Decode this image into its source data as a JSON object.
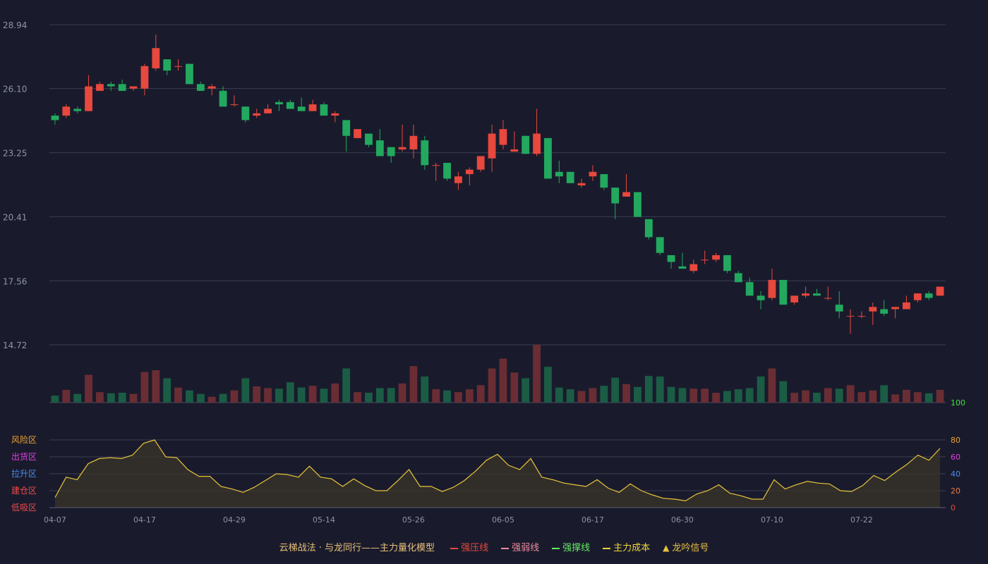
{
  "colors": {
    "up": "#e8483d",
    "down": "#22a95f",
    "vol_up": "#6a2d33",
    "vol_down": "#1b5c45",
    "line": "#e8c43a",
    "area": "#3a3528",
    "grid": "#3a3e52"
  },
  "legend": {
    "title": "云梯战法 · 与龙同行——主力量化模型",
    "title_color": "#e8c07a",
    "items": [
      {
        "label": "强压线",
        "marker": "line-solid",
        "color": "#e8483d"
      },
      {
        "label": "强弱线",
        "marker": "line-dashed",
        "color": "#f08aa0"
      },
      {
        "label": "强撑线",
        "marker": "line-solid",
        "color": "#66e866"
      },
      {
        "label": "主力成本",
        "marker": "line-dashed",
        "color": "#f0d53a"
      },
      {
        "label": "龙吟信号",
        "marker": "triangle",
        "color": "#e8c043"
      }
    ]
  },
  "chart_data": [
    {
      "type": "candlestick",
      "y_ticks": [
        "28.94",
        "26.10",
        "23.25",
        "20.41",
        "17.56",
        "14.72"
      ],
      "ylim": [
        14.72,
        28.94
      ],
      "x_labels": [
        {
          "index": 0,
          "label": "04-07"
        },
        {
          "index": 8,
          "label": "04-17"
        },
        {
          "index": 16,
          "label": "04-29"
        },
        {
          "index": 24,
          "label": "05-14"
        },
        {
          "index": 32,
          "label": "05-26"
        },
        {
          "index": 40,
          "label": "06-05"
        },
        {
          "index": 48,
          "label": "06-17"
        },
        {
          "index": 56,
          "label": "06-30"
        },
        {
          "index": 64,
          "label": "07-10"
        },
        {
          "index": 72,
          "label": "07-22"
        }
      ],
      "ohlc": [
        [
          24.9,
          25.0,
          24.5,
          24.7
        ],
        [
          24.9,
          25.4,
          24.8,
          25.3
        ],
        [
          25.2,
          25.3,
          25.0,
          25.1
        ],
        [
          25.1,
          26.7,
          25.1,
          26.2
        ],
        [
          26.0,
          26.4,
          26.0,
          26.3
        ],
        [
          26.3,
          26.4,
          26.0,
          26.2
        ],
        [
          26.3,
          26.5,
          26.0,
          26.0
        ],
        [
          26.1,
          26.2,
          26.0,
          26.2
        ],
        [
          26.1,
          27.2,
          25.8,
          27.1
        ],
        [
          27.0,
          28.5,
          26.9,
          27.9
        ],
        [
          27.4,
          27.4,
          26.7,
          26.9
        ],
        [
          27.1,
          27.4,
          26.9,
          27.1
        ],
        [
          27.2,
          27.2,
          26.3,
          26.3
        ],
        [
          26.3,
          26.4,
          26.0,
          26.0
        ],
        [
          26.1,
          26.3,
          25.8,
          26.2
        ],
        [
          26.0,
          26.2,
          25.3,
          25.3
        ],
        [
          25.4,
          25.8,
          25.3,
          25.4
        ],
        [
          25.3,
          25.3,
          24.6,
          24.7
        ],
        [
          24.9,
          25.2,
          24.8,
          25.0
        ],
        [
          25.0,
          25.4,
          25.0,
          25.2
        ],
        [
          25.5,
          25.6,
          25.1,
          25.4
        ],
        [
          25.5,
          25.6,
          25.2,
          25.2
        ],
        [
          25.3,
          25.7,
          25.2,
          25.1
        ],
        [
          25.1,
          25.6,
          25.1,
          25.4
        ],
        [
          25.4,
          25.5,
          24.9,
          24.9
        ],
        [
          24.9,
          25.1,
          24.6,
          25.0
        ],
        [
          24.7,
          24.7,
          23.3,
          24.0
        ],
        [
          23.9,
          24.3,
          23.9,
          24.3
        ],
        [
          24.1,
          24.1,
          23.5,
          23.6
        ],
        [
          23.8,
          24.3,
          23.1,
          23.1
        ],
        [
          23.5,
          23.5,
          22.8,
          23.1
        ],
        [
          23.4,
          24.5,
          23.3,
          23.5
        ],
        [
          23.4,
          24.5,
          23.0,
          24.0
        ],
        [
          23.8,
          24.0,
          22.5,
          22.7
        ],
        [
          22.7,
          22.8,
          22.0,
          22.7
        ],
        [
          22.8,
          22.8,
          22.0,
          22.1
        ],
        [
          21.9,
          22.4,
          21.6,
          22.2
        ],
        [
          22.3,
          22.6,
          21.8,
          22.5
        ],
        [
          22.5,
          23.1,
          22.4,
          23.1
        ],
        [
          23.0,
          24.5,
          22.4,
          24.1
        ],
        [
          23.6,
          24.7,
          23.4,
          24.3
        ],
        [
          23.3,
          24.2,
          23.3,
          23.4
        ],
        [
          24.0,
          24.0,
          23.2,
          23.2
        ],
        [
          23.2,
          25.2,
          23.1,
          24.1
        ],
        [
          23.9,
          23.9,
          22.1,
          22.1
        ],
        [
          22.4,
          22.9,
          21.9,
          22.2
        ],
        [
          22.4,
          22.4,
          21.9,
          21.9
        ],
        [
          21.8,
          22.1,
          21.7,
          21.9
        ],
        [
          22.2,
          22.7,
          22.0,
          22.4
        ],
        [
          22.3,
          22.3,
          21.6,
          21.7
        ],
        [
          21.7,
          21.7,
          20.3,
          21.0
        ],
        [
          21.3,
          22.3,
          21.3,
          21.5
        ],
        [
          21.5,
          21.5,
          20.4,
          20.4
        ],
        [
          20.3,
          20.3,
          19.4,
          19.5
        ],
        [
          19.5,
          19.5,
          18.7,
          18.8
        ],
        [
          18.7,
          18.7,
          18.1,
          18.4
        ],
        [
          18.2,
          18.8,
          18.1,
          18.1
        ],
        [
          18.0,
          18.5,
          17.9,
          18.3
        ],
        [
          18.5,
          18.9,
          18.3,
          18.5
        ],
        [
          18.5,
          18.8,
          18.4,
          18.7
        ],
        [
          18.7,
          18.7,
          17.9,
          18.0
        ],
        [
          17.9,
          18.0,
          17.5,
          17.5
        ],
        [
          17.5,
          17.7,
          16.9,
          16.9
        ],
        [
          16.9,
          17.1,
          16.3,
          16.7
        ],
        [
          16.8,
          18.1,
          16.7,
          17.6
        ],
        [
          17.6,
          17.6,
          16.5,
          16.5
        ],
        [
          16.6,
          16.9,
          16.5,
          16.9
        ],
        [
          16.9,
          17.3,
          16.8,
          17.0
        ],
        [
          17.0,
          17.2,
          16.9,
          16.9
        ],
        [
          16.8,
          17.3,
          16.7,
          16.8
        ],
        [
          16.5,
          17.1,
          15.9,
          16.2
        ],
        [
          16.0,
          16.3,
          15.2,
          16.0
        ],
        [
          16.0,
          16.2,
          15.9,
          16.0
        ],
        [
          16.2,
          16.6,
          15.6,
          16.4
        ],
        [
          16.3,
          16.7,
          16.0,
          16.1
        ],
        [
          16.3,
          16.4,
          15.9,
          16.4
        ],
        [
          16.3,
          16.9,
          16.3,
          16.6
        ],
        [
          16.7,
          17.0,
          16.6,
          17.0
        ],
        [
          17.0,
          17.1,
          16.7,
          16.8
        ],
        [
          16.9,
          17.3,
          16.9,
          17.3
        ]
      ],
      "volume": [
        12,
        22,
        15,
        48,
        18,
        16,
        17,
        15,
        53,
        56,
        42,
        26,
        21,
        15,
        10,
        15,
        21,
        42,
        28,
        25,
        24,
        35,
        26,
        29,
        24,
        33,
        59,
        18,
        17,
        25,
        25,
        33,
        63,
        45,
        23,
        21,
        18,
        23,
        30,
        59,
        76,
        52,
        42,
        100,
        62,
        26,
        23,
        20,
        25,
        29,
        43,
        32,
        27,
        46,
        45,
        27,
        25,
        24,
        24,
        17,
        20,
        23,
        25,
        45,
        59,
        37,
        17,
        21,
        17,
        25,
        24,
        30,
        18,
        21,
        30,
        14,
        22,
        18,
        16,
        22
      ]
    },
    {
      "type": "area",
      "ylim": [
        0,
        100
      ],
      "y_ticks_right": [
        {
          "value": 0,
          "label": "0",
          "color": "#e8483d"
        },
        {
          "value": 20,
          "label": "20",
          "color": "#f07a3a"
        },
        {
          "value": 40,
          "label": "40",
          "color": "#4a8ae8"
        },
        {
          "value": 60,
          "label": "60",
          "color": "#e040e0"
        },
        {
          "value": 80,
          "label": "80",
          "color": "#f0a030"
        },
        {
          "value": 100,
          "label": "100",
          "color": "#40e040"
        }
      ],
      "zones": [
        {
          "label": "风险区",
          "value": 80,
          "color": "#f0a030"
        },
        {
          "label": "出货区",
          "value": 60,
          "color": "#e040e0"
        },
        {
          "label": "拉升区",
          "value": 40,
          "color": "#4a8ae8"
        },
        {
          "label": "建仓区",
          "value": 20,
          "color": "#f04a4a"
        },
        {
          "label": "低吸区",
          "value": 0,
          "color": "#f04a4a"
        }
      ],
      "values": [
        12,
        36,
        33,
        52,
        58,
        59,
        58,
        62,
        76,
        80,
        60,
        59,
        45,
        37,
        37,
        25,
        22,
        18,
        24,
        32,
        40,
        39,
        36,
        49,
        36,
        34,
        25,
        34,
        26,
        20,
        20,
        32,
        45,
        25,
        25,
        19,
        24,
        32,
        43,
        56,
        63,
        50,
        45,
        58,
        36,
        33,
        29,
        27,
        25,
        33,
        23,
        18,
        28,
        20,
        15,
        11,
        10,
        8,
        16,
        20,
        27,
        17,
        14,
        10,
        10,
        33,
        22,
        27,
        31,
        29,
        28,
        20,
        19,
        26,
        38,
        32,
        42,
        51,
        62,
        56,
        70
      ]
    }
  ]
}
